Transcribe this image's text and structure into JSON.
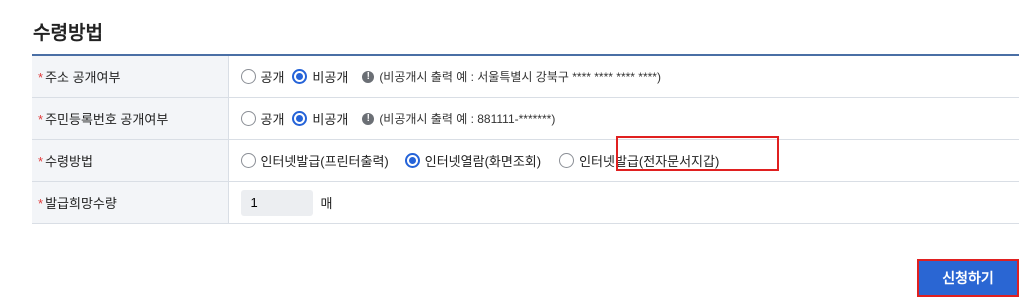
{
  "section_title": "수령방법",
  "required_mark": "*",
  "rows": {
    "address": {
      "label": "주소 공개여부",
      "options": [
        "공개",
        "비공개"
      ],
      "selected": "비공개",
      "note": "(비공개시 출력 예 : 서울특별시 강북구 **** **** **** ****)"
    },
    "resident_number": {
      "label": "주민등록번호 공개여부",
      "options": [
        "공개",
        "비공개"
      ],
      "selected": "비공개",
      "note": "(비공개시 출력 예 : 881111-*******)"
    },
    "receipt_method": {
      "label": "수령방법",
      "options": [
        "인터넷발급(프린터출력)",
        "인터넷열람(화면조회)",
        "인터넷발급(전자문서지갑)"
      ],
      "selected": "인터넷열람(화면조회)"
    },
    "quantity": {
      "label": "발급희망수량",
      "value": "1",
      "unit": "매"
    }
  },
  "submit_label": "신청하기",
  "colors": {
    "accent": "#2563d8",
    "highlight": "#e02020",
    "button": "#2a66d3"
  }
}
